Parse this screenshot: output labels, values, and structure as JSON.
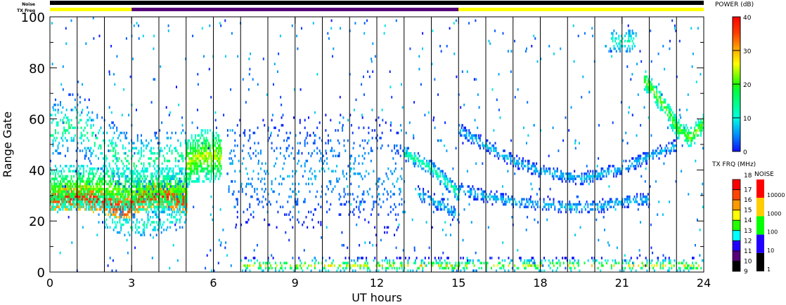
{
  "chart_data": {
    "type": "heatmap",
    "title": "",
    "xlabel": "UT hours",
    "ylabel": "Range Gate",
    "xlim": [
      0,
      24
    ],
    "ylim": [
      0,
      100
    ],
    "xticks": [
      "0",
      "3",
      "6",
      "9",
      "12",
      "15",
      "18",
      "21",
      "24"
    ],
    "yticks": [
      "0",
      "20",
      "40",
      "60",
      "80",
      "100"
    ],
    "scan_lines_hours": [
      1,
      2,
      3,
      4,
      5,
      6,
      7,
      8,
      9,
      10,
      11,
      12,
      13,
      14,
      15,
      16,
      17,
      18,
      19,
      20,
      21,
      22,
      23
    ],
    "status_bars": {
      "noise_label": "Noise",
      "txfreq_label": "TX Freq",
      "noise_segments": [
        {
          "t0": 0,
          "t1": 24,
          "color": "#000000"
        }
      ],
      "txfreq_segments": [
        {
          "t0": 0,
          "t1": 3,
          "color": "#ffff00"
        },
        {
          "t0": 3,
          "t1": 15,
          "color": "#550077"
        },
        {
          "t0": 15,
          "t1": 24,
          "color": "#ffff00"
        }
      ]
    },
    "echo_regions": [
      {
        "name": "dayside-band-core",
        "path": [
          [
            0,
            28
          ],
          [
            1,
            29
          ],
          [
            2,
            27
          ],
          [
            2.7,
            24
          ],
          [
            3.3,
            28
          ],
          [
            4,
            30
          ],
          [
            5,
            27
          ]
        ],
        "width": 5,
        "power": [
          28,
          40
        ],
        "density": 0.95
      },
      {
        "name": "dayside-band-halo",
        "path": [
          [
            0,
            32
          ],
          [
            2,
            33
          ],
          [
            3,
            31
          ],
          [
            5,
            32
          ]
        ],
        "width": 9,
        "power": [
          8,
          25
        ],
        "density": 0.75
      },
      {
        "name": "dayside-upper-scatter",
        "path": [
          [
            0,
            55
          ],
          [
            1,
            58
          ],
          [
            2,
            48
          ],
          [
            3,
            42
          ],
          [
            5,
            45
          ]
        ],
        "width": 12,
        "power": [
          2,
          18
        ],
        "density": 0.25
      },
      {
        "name": "dayside-lower-scatter",
        "path": [
          [
            2,
            20
          ],
          [
            3,
            17
          ],
          [
            4,
            19
          ],
          [
            5,
            22
          ]
        ],
        "width": 5,
        "power": [
          3,
          15
        ],
        "density": 0.35
      },
      {
        "name": "morning-patch",
        "path": [
          [
            5,
            42
          ],
          [
            5.5,
            45
          ],
          [
            6.3,
            45
          ]
        ],
        "width": 10,
        "power": [
          10,
          28
        ],
        "density": 0.8
      },
      {
        "name": "midday-scatter",
        "path": [
          [
            6.5,
            40
          ],
          [
            9,
            38
          ],
          [
            11,
            40
          ],
          [
            13,
            35
          ]
        ],
        "width": 22,
        "power": [
          0,
          8
        ],
        "density": 0.12
      },
      {
        "name": "descending-band-1",
        "path": [
          [
            13,
            46
          ],
          [
            14,
            40
          ],
          [
            15,
            30
          ]
        ],
        "width": 3,
        "power": [
          2,
          18
        ],
        "density": 0.7
      },
      {
        "name": "descending-band-2",
        "path": [
          [
            13.5,
            30
          ],
          [
            14.5,
            25
          ],
          [
            15,
            21
          ]
        ],
        "width": 3,
        "power": [
          0,
          10
        ],
        "density": 0.55
      },
      {
        "name": "evening-arc-upper",
        "path": [
          [
            15,
            55
          ],
          [
            16,
            49
          ],
          [
            17,
            43
          ],
          [
            18,
            39
          ],
          [
            19.5,
            36
          ],
          [
            21,
            40
          ],
          [
            22,
            45
          ],
          [
            23,
            49
          ]
        ],
        "width": 2.5,
        "power": [
          0,
          10
        ],
        "density": 0.6
      },
      {
        "name": "evening-arc-lower",
        "path": [
          [
            15,
            32
          ],
          [
            16,
            29
          ],
          [
            17,
            27
          ],
          [
            18,
            26
          ],
          [
            19,
            25
          ],
          [
            20,
            25
          ],
          [
            21,
            27
          ],
          [
            22,
            28
          ]
        ],
        "width": 2.5,
        "power": [
          0,
          10
        ],
        "density": 0.6
      },
      {
        "name": "late-arc",
        "path": [
          [
            21.8,
            75
          ],
          [
            22.5,
            65
          ],
          [
            23,
            56
          ],
          [
            23.5,
            52
          ],
          [
            24,
            58
          ]
        ],
        "width": 4,
        "power": [
          8,
          25
        ],
        "density": 0.75
      },
      {
        "name": "far-range-patch",
        "path": [
          [
            20.5,
            90
          ],
          [
            21.5,
            90
          ]
        ],
        "width": 4,
        "power": [
          5,
          14
        ],
        "density": 0.5
      },
      {
        "name": "ground-scatter",
        "path": [
          [
            7,
            2
          ],
          [
            24,
            2
          ]
        ],
        "width": 3,
        "power": [
          0,
          30
        ],
        "density": 0.35
      }
    ],
    "colorbars": {
      "power": {
        "title": "POWER (dB)",
        "ticks": [
          "40",
          "30",
          "20",
          "10",
          "0"
        ],
        "range": [
          0,
          40
        ]
      },
      "txfreq": {
        "title": "TX FRQ (MHz)",
        "ticks": [
          "18",
          "17",
          "16",
          "15",
          "14",
          "13",
          "12",
          "11",
          "10",
          "9"
        ],
        "colors": [
          "#ff0000",
          "#ff4400",
          "#ff9900",
          "#ffff00",
          "#22ff00",
          "#00ffff",
          "#2200ff",
          "#550077",
          "#000000"
        ]
      },
      "noise": {
        "title": "NOISE",
        "ticks": [
          "10000",
          "1000",
          "100",
          "10",
          "1"
        ],
        "colors": [
          "#ff0000",
          "#ffcc00",
          "#00ff00",
          "#2200ff",
          "#000000"
        ]
      }
    }
  }
}
